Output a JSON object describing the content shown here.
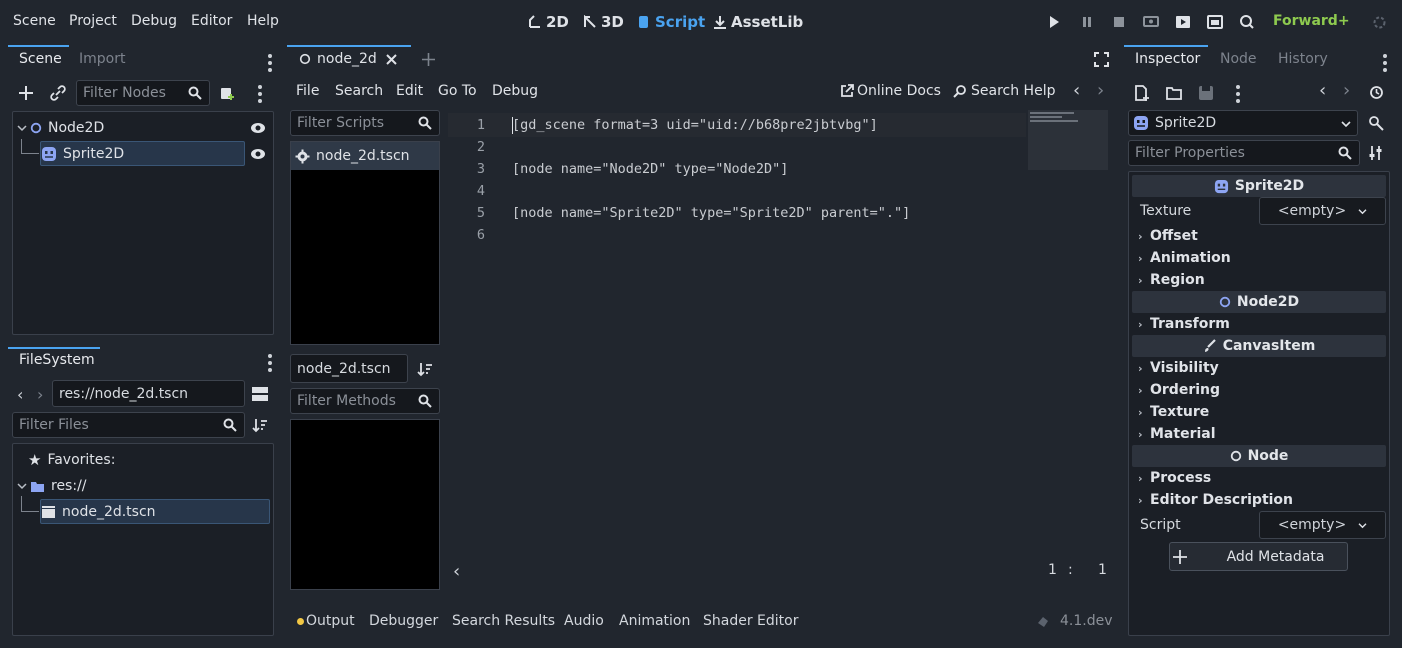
{
  "menu": {
    "scene": "Scene",
    "project": "Project",
    "debug": "Debug",
    "editor": "Editor",
    "help": "Help"
  },
  "workspaces": {
    "two_d": "2D",
    "three_d": "3D",
    "script": "Script",
    "assetlib": "AssetLib"
  },
  "renderer": "Forward+",
  "scene_dock": {
    "tabs": {
      "scene": "Scene",
      "import": "Import"
    },
    "filter_placeholder": "Filter Nodes",
    "nodes": [
      {
        "label": "Node2D",
        "icon": "node2d-circle-icon"
      },
      {
        "label": "Sprite2D",
        "icon": "sprite2d-icon"
      }
    ]
  },
  "filesystem_dock": {
    "title": "FileSystem",
    "path": "res://node_2d.tscn",
    "filter_placeholder": "Filter Files",
    "favorites": "Favorites:",
    "root": "res://",
    "file": "node_2d.tscn"
  },
  "script_editor": {
    "tab_label": "node_2d",
    "menu": {
      "file": "File",
      "search": "Search",
      "edit": "Edit",
      "goto": "Go To",
      "debug": "Debug"
    },
    "online_docs": "Online Docs",
    "search_help": "Search Help",
    "filter_scripts_placeholder": "Filter Scripts",
    "script_list_item": "node_2d.tscn",
    "current_file": "node_2d.tscn",
    "filter_methods_placeholder": "Filter Methods",
    "lines": [
      {
        "n": "1",
        "text": "[gd_scene format=3 uid=\"uid://b68pre2jbtvbg\"]"
      },
      {
        "n": "2",
        "text": ""
      },
      {
        "n": "3",
        "text": "[node name=\"Node2D\" type=\"Node2D\"]"
      },
      {
        "n": "4",
        "text": ""
      },
      {
        "n": "5",
        "text": "[node name=\"Sprite2D\" type=\"Sprite2D\" parent=\".\"]"
      },
      {
        "n": "6",
        "text": ""
      }
    ],
    "cursor_line": "1",
    "cursor_sep": ":",
    "cursor_col": "1"
  },
  "bottom_panel": {
    "output": "Output",
    "debugger": "Debugger",
    "search_results": "Search Results",
    "audio": "Audio",
    "animation": "Animation",
    "shader_editor": "Shader Editor",
    "version": "4.1.dev"
  },
  "inspector": {
    "tabs": {
      "inspector": "Inspector",
      "node": "Node",
      "history": "History"
    },
    "object": "Sprite2D",
    "filter_placeholder": "Filter Properties",
    "sections": {
      "sprite2d": "Sprite2D",
      "node2d": "Node2D",
      "canvasitem": "CanvasItem",
      "node": "Node"
    },
    "texture_label": "Texture",
    "texture_value": "<empty>",
    "groups_sprite": [
      "Offset",
      "Animation",
      "Region"
    ],
    "groups_node2d": [
      "Transform"
    ],
    "groups_canvas": [
      "Visibility",
      "Ordering",
      "Texture",
      "Material"
    ],
    "groups_node": [
      "Process",
      "Editor Description"
    ],
    "script_label": "Script",
    "script_value": "<empty>",
    "add_metadata": "Add Metadata"
  },
  "colors": {
    "accent": "#4aa3f0",
    "renderer_green": "#8eca4f",
    "output_dot": "#f2c744"
  }
}
